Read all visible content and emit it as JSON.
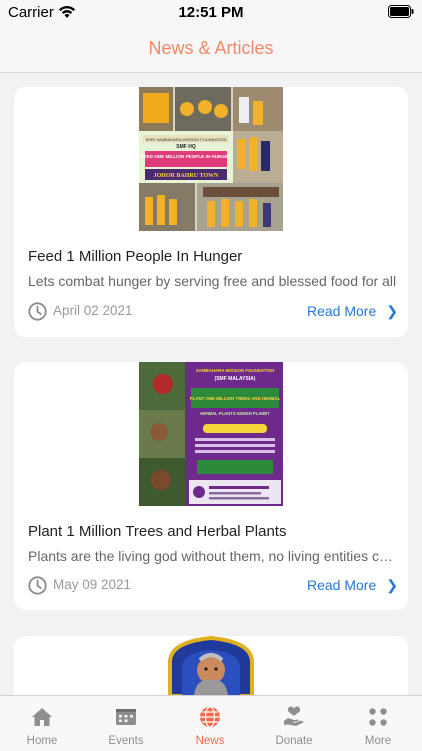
{
  "status_bar": {
    "carrier": "Carrier",
    "time": "12:51 PM"
  },
  "header": {
    "title": "News & Articles"
  },
  "articles": [
    {
      "poster_text": [
        "SHRI SAMBAHARA MISSION FOUNDATION",
        "SMF HQ",
        "FEED ONE MILLION PEOPLE IN HUNGER",
        "JOHOR BAHRU TOWN"
      ],
      "title": "Feed 1 Million People In Hunger",
      "excerpt": "Lets combat hunger by serving free and blessed food for all",
      "date": "April 02 2021",
      "read_more": "Read More"
    },
    {
      "poster_text": [
        "SAMBAHARA MISSION FOUNDATION",
        "(SMF MALAYSIA)",
        "PLANT ONE MILLION TREES AND HERBAL",
        "HERBAL PLANTS-GREEN PLANET"
      ],
      "title": "Plant 1 Million Trees and Herbal Plants",
      "excerpt": "Plants are the living god without them, no living entities can survive",
      "date": "May 09 2021",
      "read_more": "Read More"
    }
  ],
  "tabs": [
    {
      "label": "Home",
      "icon": "home-icon"
    },
    {
      "label": "Events",
      "icon": "events-icon"
    },
    {
      "label": "News",
      "icon": "globe-icon",
      "active": true
    },
    {
      "label": "Donate",
      "icon": "donate-icon"
    },
    {
      "label": "More",
      "icon": "more-icon"
    }
  ],
  "colors": {
    "accent": "#f06a4a",
    "link": "#2478d6",
    "title": "#f08868"
  }
}
